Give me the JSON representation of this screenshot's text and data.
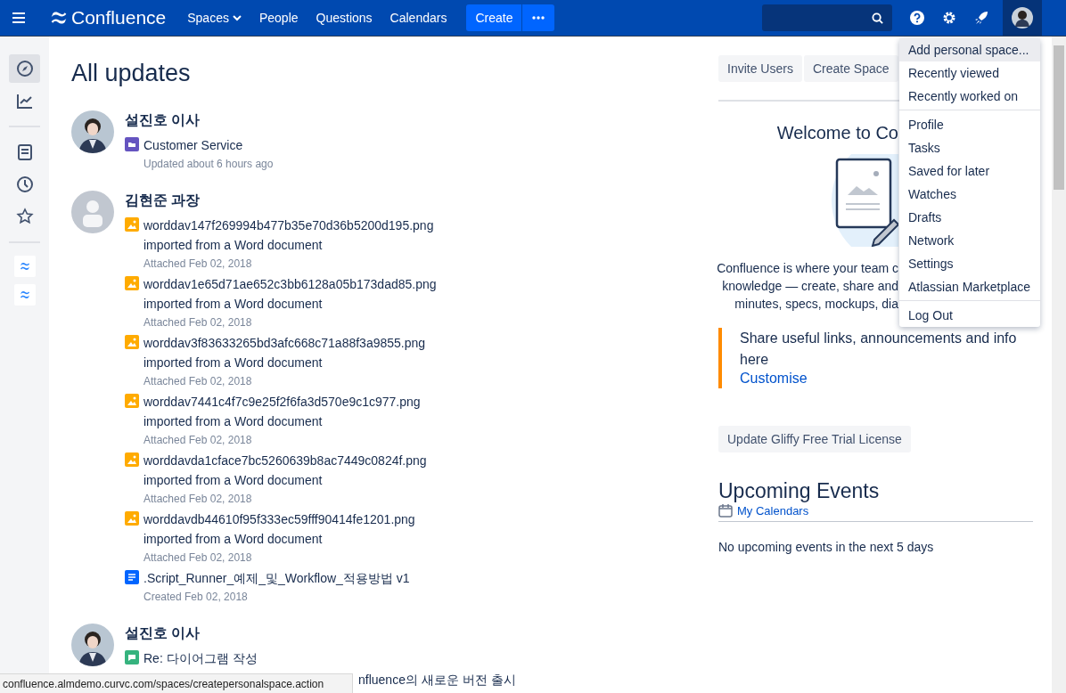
{
  "nav": {
    "logo": "Confluence",
    "links": [
      {
        "label": "Spaces",
        "dropdown": true
      },
      {
        "label": "People",
        "dropdown": false
      },
      {
        "label": "Questions",
        "dropdown": false
      },
      {
        "label": "Calendars",
        "dropdown": false
      }
    ],
    "create": "Create",
    "user_menu_open": true
  },
  "sidebar": {
    "items": [
      {
        "kind": "compass",
        "selected": true
      },
      {
        "kind": "chart",
        "selected": false
      },
      {
        "kind": "divider"
      },
      {
        "kind": "page",
        "selected": false
      },
      {
        "kind": "clock",
        "selected": false
      },
      {
        "kind": "star",
        "selected": false
      },
      {
        "kind": "divider"
      },
      {
        "kind": "space"
      },
      {
        "kind": "space"
      }
    ]
  },
  "main": {
    "title": "All updates",
    "feed": [
      {
        "author": "설진호 이사",
        "avatar": {
          "kind": "photo"
        },
        "items": [
          {
            "kind": "space",
            "title": "Customer Service",
            "meta": "Updated about 6 hours ago"
          }
        ]
      },
      {
        "author": "김현준 과장",
        "avatar": {
          "kind": "default"
        },
        "items": [
          {
            "kind": "image",
            "title": "worddav147f269994b477b35e70d36b5200d195.png",
            "desc": "imported from a Word document",
            "meta": "Attached Feb 02, 2018"
          },
          {
            "kind": "image",
            "title": "worddav1e65d71ae652c3bb6128a05b173dad85.png",
            "desc": "imported from a Word document",
            "meta": "Attached Feb 02, 2018"
          },
          {
            "kind": "image",
            "title": "worddav3f83633265bd3afc668c71a88f3a9855.png",
            "desc": "imported from a Word document",
            "meta": "Attached Feb 02, 2018"
          },
          {
            "kind": "image",
            "title": "worddav7441c4f7c9e25f2f6fa3d570e9c1c977.png",
            "desc": "imported from a Word document",
            "meta": "Attached Feb 02, 2018"
          },
          {
            "kind": "image",
            "title": "worddavda1cface7bc5260639b8ac7449c0824f.png",
            "desc": "imported from a Word document",
            "meta": "Attached Feb 02, 2018"
          },
          {
            "kind": "image",
            "title": "worddavdb44610f95f333ec59fff90414fe1201.png",
            "desc": "imported from a Word document",
            "meta": "Attached Feb 02, 2018"
          },
          {
            "kind": "page",
            "title": ".Script_Runner_예제_및_Workflow_적용방법 v1",
            "meta": "Created Feb 02, 2018"
          }
        ]
      },
      {
        "author": "설진호 이사",
        "avatar": {
          "kind": "photo"
        },
        "items": [
          {
            "kind": "comment",
            "title": "Re: 다이어그램 작성"
          },
          {
            "kind": "covered",
            "title": "nfluence의 새로운 버전 출시"
          }
        ]
      }
    ]
  },
  "aside": {
    "buttons": [
      "Invite Users",
      "Create Space"
    ],
    "welcome_title": "Welcome to Co",
    "welcome_lines": [
      "Confluence is where your team c",
      "knowledge — create, share and",
      "minutes, specs, mockups, dia"
    ],
    "info": "Share useful links, announcements and info here",
    "info_link": "Customise",
    "license_button": "Update Gliffy Free Trial License",
    "events_title": "Upcoming Events",
    "calendars_link": "My Calendars",
    "events_empty": "No upcoming events in the next 5 days"
  },
  "user_menu": [
    {
      "label": "Add personal space...",
      "selected": true,
      "divider_above": false
    },
    {
      "label": "Recently viewed",
      "selected": false,
      "divider_above": false
    },
    {
      "label": "Recently worked on",
      "selected": false,
      "divider_above": false
    },
    {
      "label": "Profile",
      "selected": false,
      "divider_above": true
    },
    {
      "label": "Tasks",
      "selected": false,
      "divider_above": false
    },
    {
      "label": "Saved for later",
      "selected": false,
      "divider_above": false
    },
    {
      "label": "Watches",
      "selected": false,
      "divider_above": false
    },
    {
      "label": "Drafts",
      "selected": false,
      "divider_above": false
    },
    {
      "label": "Network",
      "selected": false,
      "divider_above": false
    },
    {
      "label": "Settings",
      "selected": false,
      "divider_above": false
    },
    {
      "label": "Atlassian Marketplace",
      "selected": false,
      "divider_above": false
    },
    {
      "label": "Log Out",
      "selected": false,
      "divider_above": true
    }
  ],
  "status_bar": "confluence.almdemo.curvc.com/spaces/createpersonalspace.action"
}
